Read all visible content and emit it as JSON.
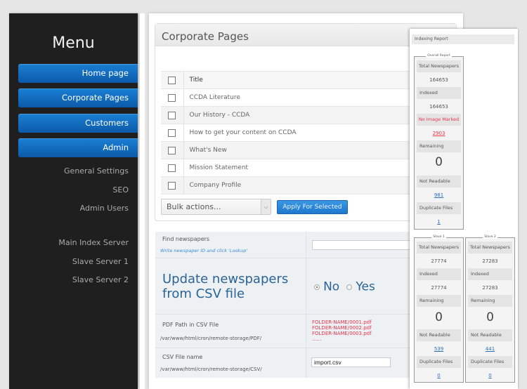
{
  "sidebar": {
    "title": "Menu",
    "buttons": [
      {
        "label": "Home page"
      },
      {
        "label": "Corporate Pages"
      },
      {
        "label": "Customers"
      },
      {
        "label": "Admin"
      }
    ],
    "admin_links": [
      {
        "label": "General Settings"
      },
      {
        "label": "SEO"
      },
      {
        "label": "Admin Users"
      }
    ],
    "server_links": [
      {
        "label": "Main Index Server"
      },
      {
        "label": "Slave Server 1"
      },
      {
        "label": "Slave Server 2"
      }
    ]
  },
  "pages": {
    "title": "Corporate Pages",
    "column_title": "Title",
    "rows": [
      {
        "title": "CCDA Literature"
      },
      {
        "title": "Our History - CCDA"
      },
      {
        "title": "How to get your content on CCDA"
      },
      {
        "title": "What's New"
      },
      {
        "title": "Mission Statement"
      },
      {
        "title": "Company Profile"
      }
    ],
    "bulk_select_value": "Bulk actions...",
    "apply_label": "Apply For Selected"
  },
  "form": {
    "find_label": "Find newspapers",
    "find_hint": "Write newspaper ID and click 'Lookup'",
    "find_value": "",
    "update_label_line1": "Update newspapers",
    "update_label_line2": "from CSV file",
    "radio_no": "No",
    "radio_yes": "Yes",
    "radio_selected": "No",
    "pdf_label": "PDF Path in CSV File",
    "pdf_path": "/var/www/html/cron/remote-storage/PDF/",
    "pdf_examples": [
      "FOLDER-NAME/0001.pdf",
      "FOLDER-NAME/0002.pdf",
      "FOLDER-NAME/0003.pdf",
      "......"
    ],
    "csv_label": "CSV File name",
    "csv_path": "/var/www/html/cron/remote-storage/CSV/",
    "csv_value": "import.csv"
  },
  "report": {
    "title": "Indexing Report",
    "overall": {
      "legend": "Overall Report",
      "total_label": "Total Newspapers",
      "total": "164653",
      "indexed_label": "Indexed",
      "indexed": "164653",
      "no_image_label": "No Image Marked",
      "no_image": "2903",
      "remaining_label": "Remaining",
      "remaining": "0",
      "not_readable_label": "Not Readable",
      "not_readable": "981",
      "duplicate_label": "Duplicate Files",
      "duplicate": "1"
    },
    "slaves": [
      {
        "legend": "Slave 1",
        "total_label": "Total Newspapers",
        "total": "27774",
        "indexed_label": "Indexed",
        "indexed": "27774",
        "remaining_label": "Remaining",
        "remaining": "0",
        "not_readable_label": "Not Readable",
        "not_readable": "539",
        "duplicate_label": "Duplicate Files",
        "duplicate": "0"
      },
      {
        "legend": "Slave 2",
        "total_label": "Total Newspapers",
        "total": "27283",
        "indexed_label": "Indexed",
        "indexed": "27283",
        "remaining_label": "Remaining",
        "remaining": "0",
        "not_readable_label": "Not Readable",
        "not_readable": "441",
        "duplicate_label": "Duplicate Files",
        "duplicate": "0"
      }
    ]
  }
}
